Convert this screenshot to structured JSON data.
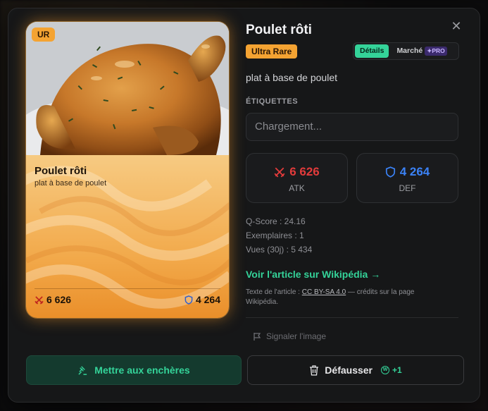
{
  "modal": {
    "title": "Poulet rôti",
    "rarity_label": "Ultra Rare",
    "subtitle": "plat à base de poulet",
    "tabs": [
      {
        "label": "Détails",
        "active": true
      },
      {
        "label": "Marché",
        "badge": "PRO",
        "active": false
      }
    ],
    "tags_label": "ÉTIQUETTES",
    "tags_placeholder": "Chargement...",
    "atk_value": "6 626",
    "atk_label": "ATK",
    "def_value": "4 264",
    "def_label": "DEF",
    "meta_qscore": "Q-Score : 24.16",
    "meta_copies": "Exemplaires : 1",
    "meta_views": "Vues (30j) : 5 434",
    "wiki_link": "Voir l'article sur Wikipédia →",
    "license_prefix": "Texte de l'article : ",
    "license_name": "CC BY-SA 4.0",
    "license_suffix": " — crédits sur la page Wikipédia.",
    "report_label": "Signaler l'image",
    "auction_button": "Mettre aux enchères",
    "discard_button": "Défausser",
    "discard_reward": "+1"
  },
  "card": {
    "rarity_short": "UR",
    "title": "Poulet rôti",
    "description": "plat à base de poulet",
    "atk": "6 626",
    "def": "4 264"
  },
  "colors": {
    "accent": "#34d399",
    "rarity": "#f4a332",
    "atk": "#e23b3b",
    "def": "#3b82f6"
  }
}
